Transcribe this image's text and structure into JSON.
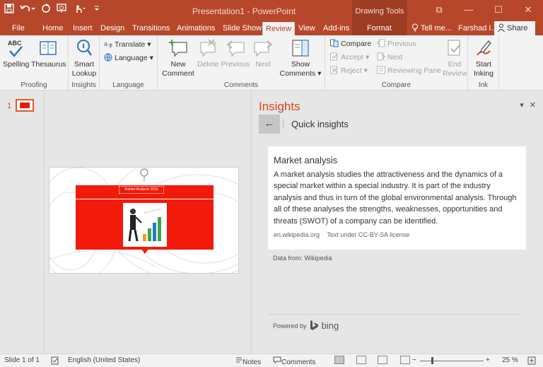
{
  "window": {
    "title": "Presentation1 - PowerPoint",
    "contextual_group": "Drawing Tools",
    "controls": [
      "⧉",
      "—",
      "☐",
      "✕"
    ]
  },
  "qat": [
    "save-icon",
    "undo-icon",
    "redo-icon",
    "present-icon",
    "touch-icon",
    "customize-icon"
  ],
  "tabs": [
    "File",
    "Home",
    "Insert",
    "Design",
    "Transitions",
    "Animations",
    "Slide Show",
    "Review",
    "View",
    "Add-ins",
    "Format",
    "Tell me...",
    "Farshad I..."
  ],
  "active_tab": "Review",
  "share_label": "Share",
  "ribbon": {
    "proofing": {
      "label": "Proofing",
      "spelling": "Spelling",
      "thesaurus": "Thesaurus"
    },
    "insights": {
      "label": "Insights",
      "smart_lookup_1": "Smart",
      "smart_lookup_2": "Lookup"
    },
    "language": {
      "label": "Language",
      "translate": "Translate",
      "language": "Language"
    },
    "comments": {
      "label": "Comments",
      "new_1": "New",
      "new_2": "Comment",
      "delete": "Delete",
      "previous": "Previous",
      "next": "Next",
      "show_1": "Show",
      "show_2": "Comments"
    },
    "compare": {
      "label": "Compare",
      "compare": "Compare",
      "accept": "Accept",
      "reject": "Reject",
      "previous": "Previous",
      "next": "Next",
      "reviewing_pane": "Reviewing Pane",
      "end_1": "End",
      "end_2": "Review"
    },
    "ink": {
      "label": "Ink",
      "start_1": "Start",
      "start_2": "Inking"
    }
  },
  "thumbnails": {
    "number": "1"
  },
  "slide": {
    "title_text": "Market Analysis 2016"
  },
  "insights": {
    "title": "Insights",
    "controls": [
      "▾",
      "✕"
    ],
    "back": "←",
    "subtitle": "Quick insights",
    "card": {
      "title": "Market analysis",
      "body": "A market analysis studies the attractiveness and the dynamics of a special market within a special industry. It is part of the industry analysis and thus in turn of the global environmental analysis. Through all of these analyses the strengths, weaknesses, opportunities and threats (SWOT) of a company can be identified.",
      "source": "en.wikipedia.org",
      "license": "Text under CC-BY-SA license"
    },
    "data_from": "Data from: Wikipedia",
    "powered_by": "Powered by",
    "bing": "bing"
  },
  "status": {
    "slide_count": "Slide 1 of 1",
    "language": "English (United States)",
    "notes": "Notes",
    "comments": "Comments",
    "zoom_minus": "−",
    "zoom_plus": "+",
    "zoom": "25 %"
  },
  "colors": {
    "accent": "#b7472a",
    "insights_title": "#d24726",
    "slide_red": "#f21a0a"
  }
}
